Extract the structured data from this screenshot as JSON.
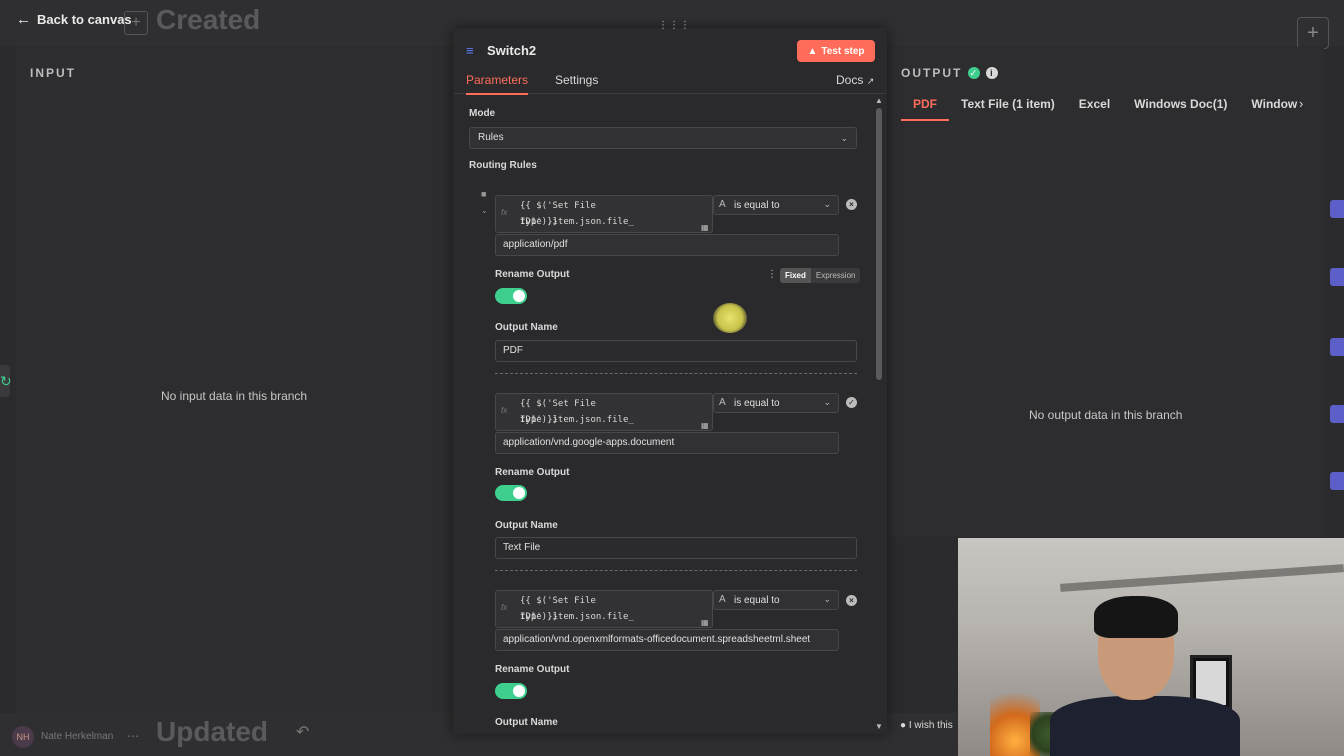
{
  "header": {
    "back_label": "Back to canvas",
    "workflow_title": "Created"
  },
  "input_panel": {
    "title": "INPUT",
    "empty_message": "No input data in this branch"
  },
  "output_panel": {
    "title": "OUTPUT",
    "tabs": [
      "PDF",
      "Text File (1 item)",
      "Excel",
      "Windows Doc(1)",
      "Window"
    ],
    "active_tab": "PDF",
    "empty_message": "No output data in this branch"
  },
  "node": {
    "name": "Switch2",
    "test_button": "Test step",
    "tabs": {
      "parameters": "Parameters",
      "settings": "Settings",
      "docs": "Docs"
    },
    "mode_label": "Mode",
    "mode_value": "Rules",
    "routing_rules_label": "Routing Rules",
    "fixed_label": "Fixed",
    "expression_label": "Expression",
    "rules": [
      {
        "expr_line1": "{{ $('Set File ID1').item.json.file_",
        "expr_line2": "type }}",
        "operator": "is equal to",
        "value": "application/pdf",
        "rename_label": "Rename Output",
        "rename_on": true,
        "output_name_label": "Output Name",
        "output_name": "PDF"
      },
      {
        "expr_line1": "{{ $('Set File ID1').item.json.file_",
        "expr_line2": "type }}",
        "operator": "is equal to",
        "value": "application/vnd.google-apps.document",
        "rename_label": "Rename Output",
        "rename_on": true,
        "output_name_label": "Output Name",
        "output_name": "Text File"
      },
      {
        "expr_line1": "{{ $('Set File ID1').item.json.file_",
        "expr_line2": "type }}",
        "operator": "is equal to",
        "value": "application/vnd.openxmlformats-officedocument.spreadsheetml.sheet",
        "rename_label": "Rename Output",
        "rename_on": true,
        "output_name_label": "Output Name",
        "output_name": ""
      }
    ]
  },
  "footer": {
    "user_name": "Nate Herkelman",
    "user_initials": "NH",
    "status_title": "Updated",
    "wish_text": "I wish this"
  },
  "colors": {
    "accent": "#ff6d5a",
    "success": "#3ecf8e",
    "node_icon": "#5c7cfa"
  }
}
